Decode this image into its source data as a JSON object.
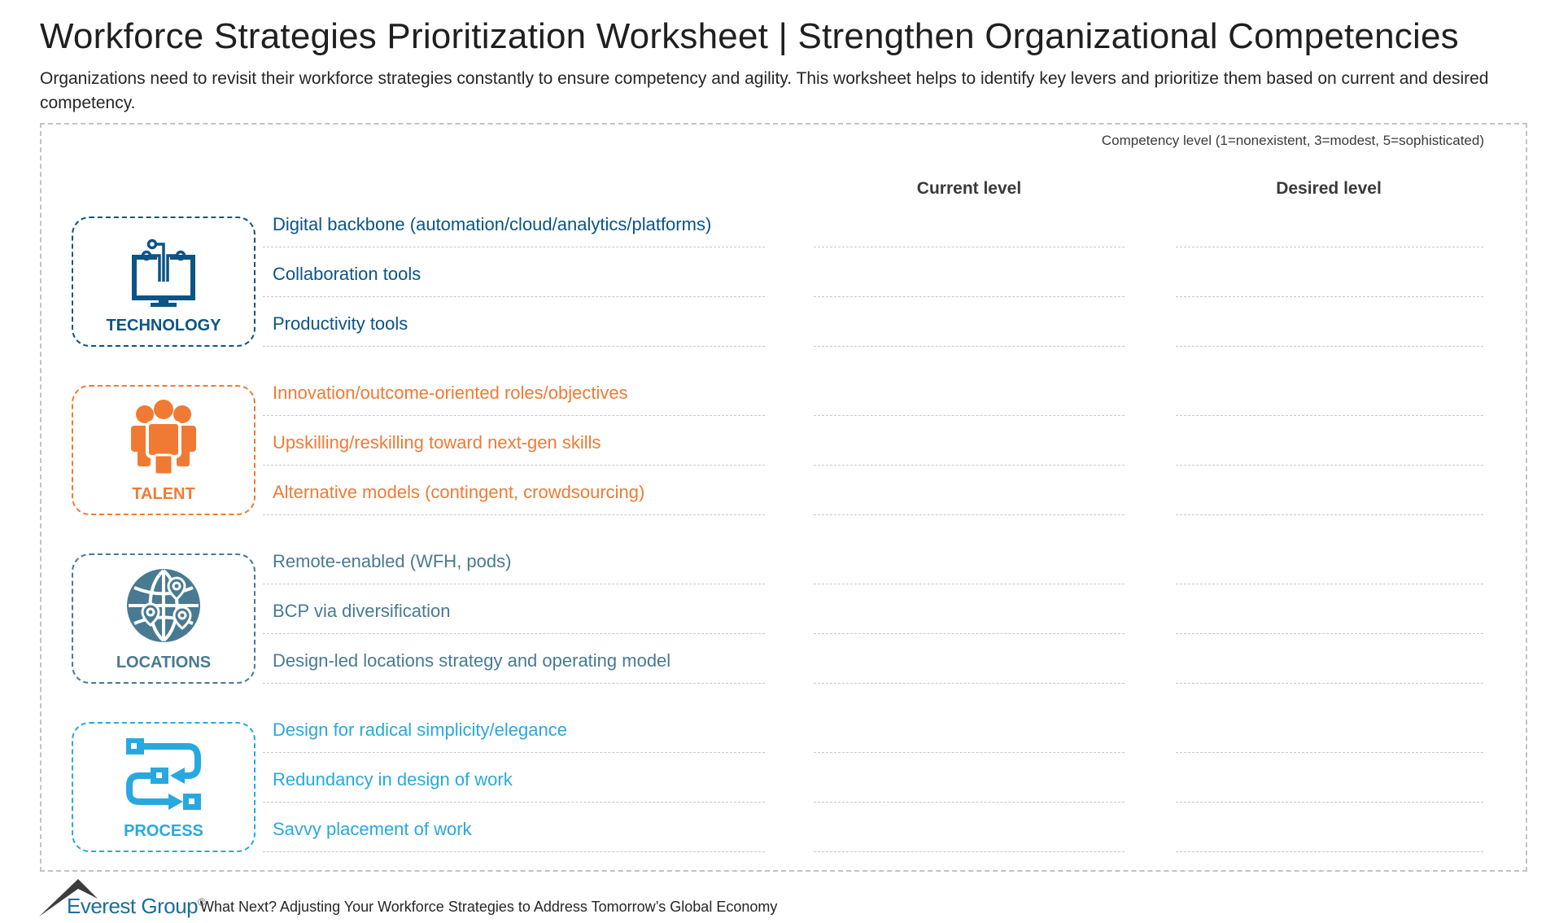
{
  "header": {
    "title": "Workforce Strategies Prioritization Worksheet | Strengthen Organizational Competencies",
    "subtitle": "Organizations need to revisit their workforce strategies constantly to ensure competency and agility. This worksheet helps to identify key levers and prioritize them based on current and desired competency."
  },
  "worksheet": {
    "competency_note": "Competency level (1=nonexistent, 3=modest, 5=sophisticated)",
    "columns": {
      "current": "Current level",
      "desired": "Desired level"
    },
    "categories": [
      {
        "label": "TECHNOLOGY",
        "icon": "computer-circuit-icon",
        "color": "#0b5486",
        "items": [
          {
            "text": "Digital backbone (automation/cloud/analytics/platforms)",
            "current": "",
            "desired": ""
          },
          {
            "text": "Collaboration tools",
            "current": "",
            "desired": ""
          },
          {
            "text": "Productivity tools",
            "current": "",
            "desired": ""
          }
        ]
      },
      {
        "label": "TALENT",
        "icon": "people-group-icon",
        "color": "#f07a34",
        "items": [
          {
            "text": "Innovation/outcome-oriented roles/objectives",
            "current": "",
            "desired": ""
          },
          {
            "text": "Upskilling/reskilling toward next-gen skills",
            "current": "",
            "desired": ""
          },
          {
            "text": "Alternative models (contingent, crowdsourcing)",
            "current": "",
            "desired": ""
          }
        ]
      },
      {
        "label": "LOCATIONS",
        "icon": "globe-pins-icon",
        "color": "#487a92",
        "items": [
          {
            "text": "Remote-enabled (WFH, pods)",
            "current": "",
            "desired": ""
          },
          {
            "text": "BCP via diversification",
            "current": "",
            "desired": ""
          },
          {
            "text": "Design-led locations strategy and operating model",
            "current": "",
            "desired": ""
          }
        ]
      },
      {
        "label": "PROCESS",
        "icon": "process-flow-icon",
        "color": "#29a8e0",
        "items": [
          {
            "text": "Design for radical simplicity/elegance",
            "current": "",
            "desired": ""
          },
          {
            "text": "Redundancy in design of work",
            "current": "",
            "desired": ""
          },
          {
            "text": "Savvy placement of work",
            "current": "",
            "desired": ""
          }
        ]
      }
    ]
  },
  "footer": {
    "brand": "Everest Group",
    "registered": "®",
    "report_title": "What Next? Adjusting Your Workforce Strategies to Address Tomorrow’s Global Economy"
  }
}
